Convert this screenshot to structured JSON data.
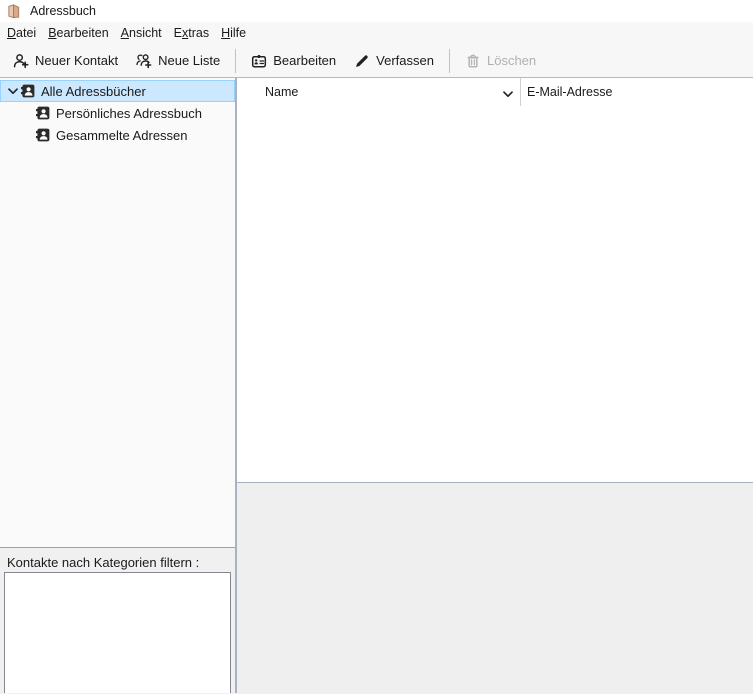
{
  "window": {
    "title": "Adressbuch"
  },
  "menu_bar": {
    "items": [
      {
        "label": "Datei",
        "mnemonic_index": 0
      },
      {
        "label": "Bearbeiten",
        "mnemonic_index": 0
      },
      {
        "label": "Ansicht",
        "mnemonic_index": 0
      },
      {
        "label": "Extras",
        "mnemonic_index": 1
      },
      {
        "label": "Hilfe",
        "mnemonic_index": 0
      }
    ]
  },
  "toolbar": {
    "buttons": [
      {
        "label": "Neuer Kontakt",
        "icon": "new-contact-icon",
        "enabled": true
      },
      {
        "label": "Neue Liste",
        "icon": "new-list-icon",
        "enabled": true
      },
      {
        "label": "Bearbeiten",
        "icon": "edit-contact-icon",
        "enabled": true
      },
      {
        "label": "Verfassen",
        "icon": "compose-icon",
        "enabled": true
      },
      {
        "label": "Löschen",
        "icon": "trash-icon",
        "enabled": false
      }
    ]
  },
  "sidebar": {
    "tree": [
      {
        "label": "Alle Adressbücher",
        "level": 0,
        "expanded": true,
        "selected": true
      },
      {
        "label": "Persönliches Adressbuch",
        "level": 1,
        "expanded": false,
        "selected": false
      },
      {
        "label": "Gesammelte Adressen",
        "level": 1,
        "expanded": false,
        "selected": false
      }
    ],
    "category_filter": {
      "label": "Kontakte nach Kategorien filtern :",
      "items": []
    }
  },
  "contact_list": {
    "columns": [
      {
        "label": "Name",
        "has_sort_chevron": true
      },
      {
        "label": "E-Mail-Adresse",
        "has_sort_chevron": false
      }
    ],
    "rows": []
  },
  "colors": {
    "selection_bg": "#cce8ff",
    "selection_border": "#99d1ff",
    "chrome_bg": "#f7f7f7",
    "list_bg": "#ffffff",
    "detail_pane_bg": "#efefef",
    "splitter": "#a9b1c2",
    "disabled_text": "#b0b0b0",
    "book_icon_tan": "#d9a98c"
  }
}
